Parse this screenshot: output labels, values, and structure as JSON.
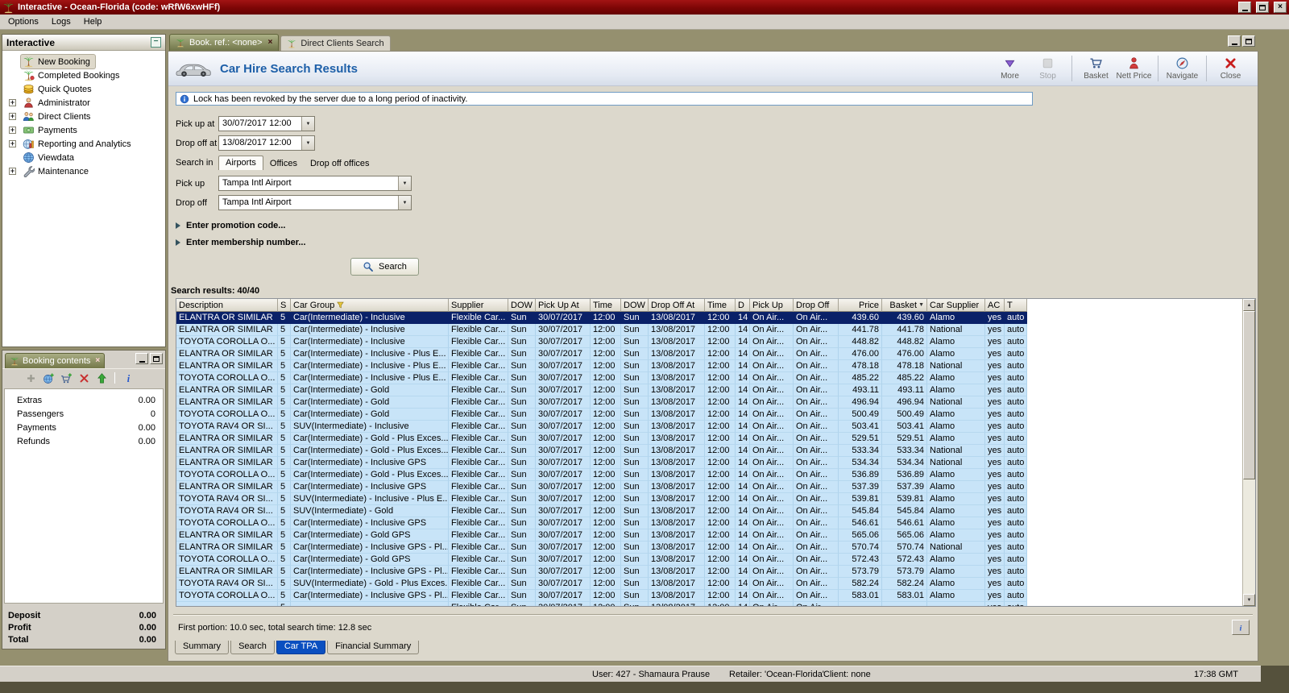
{
  "window": {
    "title": "Interactive - Ocean-Florida (code: wRfW6xwHFf)",
    "menu": [
      {
        "label": "Options"
      },
      {
        "label": "Logs"
      },
      {
        "label": "Help"
      }
    ]
  },
  "sidebar": {
    "title": "Interactive",
    "items": [
      {
        "label": "New Booking",
        "icon": "palm-tree-icon",
        "expandable": false,
        "selected": true
      },
      {
        "label": "Completed Bookings",
        "icon": "completed-bookings-icon",
        "expandable": false
      },
      {
        "label": "Quick Quotes",
        "icon": "quick-quotes-icon",
        "expandable": false
      },
      {
        "label": "Administrator",
        "icon": "administrator-icon",
        "expandable": true
      },
      {
        "label": "Direct Clients",
        "icon": "direct-clients-icon",
        "expandable": true
      },
      {
        "label": "Payments",
        "icon": "payments-icon",
        "expandable": true
      },
      {
        "label": "Reporting and Analytics",
        "icon": "reporting-icon",
        "expandable": true
      },
      {
        "label": "Viewdata",
        "icon": "viewdata-icon",
        "expandable": false
      },
      {
        "label": "Maintenance",
        "icon": "maintenance-icon",
        "expandable": true
      }
    ]
  },
  "booking_contents": {
    "title": "Booking contents",
    "toolbar": [
      {
        "icon": "add-icon"
      },
      {
        "icon": "globe-add-icon"
      },
      {
        "icon": "basket-add-icon"
      },
      {
        "icon": "delete-icon"
      },
      {
        "icon": "export-up-icon"
      },
      {
        "icon": "info-icon",
        "sep_before": true
      }
    ],
    "items": [
      {
        "label": "Extras",
        "value": "0.00"
      },
      {
        "label": "Passengers",
        "value": "0"
      },
      {
        "label": "Payments",
        "value": "0.00"
      },
      {
        "label": "Refunds",
        "value": "0.00"
      }
    ],
    "totals": [
      {
        "label": "Deposit",
        "value": "0.00"
      },
      {
        "label": "Profit",
        "value": "0.00"
      },
      {
        "label": "Total",
        "value": "0.00"
      }
    ]
  },
  "tabs": [
    {
      "label": "Book. ref.: <none>",
      "active": true,
      "closable": true,
      "icon": "palm-tree-icon"
    },
    {
      "label": "Direct Clients Search",
      "active": false,
      "closable": false,
      "icon": "palm-tree-icon"
    }
  ],
  "main": {
    "title": "Car Hire Search Results",
    "info_message": "Lock has been revoked by the server due to a long period of inactivity.",
    "toolbar": [
      {
        "label": "More",
        "icon": "more-icon"
      },
      {
        "label": "Stop",
        "icon": "stop-icon",
        "disabled": true,
        "sep_after": true
      },
      {
        "label": "Basket",
        "icon": "basket-icon"
      },
      {
        "label": "Nett Price",
        "icon": "nett-price-icon",
        "sep_after": true
      },
      {
        "label": "Navigate",
        "icon": "navigate-icon",
        "sep_after": true
      },
      {
        "label": "Close",
        "icon": "close-icon"
      }
    ],
    "form": {
      "pick_up_at": {
        "label": "Pick up at",
        "value": "30/07/2017 12:00"
      },
      "drop_off_at": {
        "label": "Drop off at",
        "value": "13/08/2017 12:00"
      },
      "search_in": {
        "label": "Search in",
        "options": [
          "Airports",
          "Offices",
          "Drop off offices"
        ],
        "selected": "Airports"
      },
      "pick_up": {
        "label": "Pick up",
        "value": "Tampa Intl Airport"
      },
      "drop_off": {
        "label": "Drop off",
        "value": "Tampa Intl Airport"
      }
    },
    "promotion_expander": "Enter promotion code...",
    "membership_expander": "Enter membership number...",
    "search_button": "Search",
    "results_label": "Search results: 40/40",
    "footer_status": "First portion: 10.0 sec, total search time: 12.8 sec",
    "bottom_tabs": [
      {
        "label": "Summary"
      },
      {
        "label": "Search"
      },
      {
        "label": "Car TPA",
        "active": true
      },
      {
        "label": "Financial Summary"
      }
    ]
  },
  "table": {
    "headers": [
      "Description",
      "S",
      "Car Group",
      "Supplier",
      "DOW",
      "Pick Up At",
      "Time",
      "DOW",
      "Drop Off At",
      "Time",
      "D",
      "Pick Up",
      "Drop Off",
      "Price",
      "Basket",
      "Car Supplier",
      "AC",
      "T"
    ],
    "shared": {
      "seats": "5",
      "supplier": "Flexible Car...",
      "dow_pickup": "Sun",
      "pickup_date": "30/07/2017",
      "pickup_time": "12:00",
      "dow_dropoff": "Sun",
      "dropoff_date": "13/08/2017",
      "dropoff_time": "12:00",
      "days": "14",
      "pickup_location": "On Air...",
      "dropoff_location": "On Air...",
      "ac": "yes",
      "transmission": "auto"
    },
    "rows": [
      {
        "description": "ELANTRA OR SIMILAR",
        "car_group": "Car(Intermediate) - Inclusive",
        "price": "439.60",
        "basket": "439.60",
        "car_supplier": "Alamo",
        "selected": true
      },
      {
        "description": "ELANTRA OR SIMILAR",
        "car_group": "Car(Intermediate) - Inclusive",
        "price": "441.78",
        "basket": "441.78",
        "car_supplier": "National"
      },
      {
        "description": "TOYOTA COROLLA O...",
        "car_group": "Car(Intermediate) - Inclusive",
        "price": "448.82",
        "basket": "448.82",
        "car_supplier": "Alamo"
      },
      {
        "description": "ELANTRA OR SIMILAR",
        "car_group": "Car(Intermediate) - Inclusive - Plus E...",
        "price": "476.00",
        "basket": "476.00",
        "car_supplier": "Alamo"
      },
      {
        "description": "ELANTRA OR SIMILAR",
        "car_group": "Car(Intermediate) - Inclusive - Plus E...",
        "price": "478.18",
        "basket": "478.18",
        "car_supplier": "National"
      },
      {
        "description": "TOYOTA COROLLA O...",
        "car_group": "Car(Intermediate) - Inclusive - Plus E...",
        "price": "485.22",
        "basket": "485.22",
        "car_supplier": "Alamo"
      },
      {
        "description": "ELANTRA OR SIMILAR",
        "car_group": "Car(Intermediate) - Gold",
        "price": "493.11",
        "basket": "493.11",
        "car_supplier": "Alamo"
      },
      {
        "description": "ELANTRA OR SIMILAR",
        "car_group": "Car(Intermediate) - Gold",
        "price": "496.94",
        "basket": "496.94",
        "car_supplier": "National"
      },
      {
        "description": "TOYOTA COROLLA O...",
        "car_group": "Car(Intermediate) - Gold",
        "price": "500.49",
        "basket": "500.49",
        "car_supplier": "Alamo"
      },
      {
        "description": "TOYOTA RAV4 OR SI...",
        "car_group": "SUV(Intermediate) - Inclusive",
        "price": "503.41",
        "basket": "503.41",
        "car_supplier": "Alamo"
      },
      {
        "description": "ELANTRA OR SIMILAR",
        "car_group": "Car(Intermediate) - Gold - Plus Exces...",
        "price": "529.51",
        "basket": "529.51",
        "car_supplier": "Alamo"
      },
      {
        "description": "ELANTRA OR SIMILAR",
        "car_group": "Car(Intermediate) - Gold - Plus Exces...",
        "price": "533.34",
        "basket": "533.34",
        "car_supplier": "National"
      },
      {
        "description": "ELANTRA OR SIMILAR",
        "car_group": "Car(Intermediate) - Inclusive GPS",
        "price": "534.34",
        "basket": "534.34",
        "car_supplier": "National"
      },
      {
        "description": "TOYOTA COROLLA O...",
        "car_group": "Car(Intermediate) - Gold - Plus Exces...",
        "price": "536.89",
        "basket": "536.89",
        "car_supplier": "Alamo"
      },
      {
        "description": "ELANTRA OR SIMILAR",
        "car_group": "Car(Intermediate) - Inclusive GPS",
        "price": "537.39",
        "basket": "537.39",
        "car_supplier": "Alamo"
      },
      {
        "description": "TOYOTA RAV4 OR SI...",
        "car_group": "SUV(Intermediate) - Inclusive - Plus E...",
        "price": "539.81",
        "basket": "539.81",
        "car_supplier": "Alamo"
      },
      {
        "description": "TOYOTA RAV4 OR SI...",
        "car_group": "SUV(Intermediate) - Gold",
        "price": "545.84",
        "basket": "545.84",
        "car_supplier": "Alamo"
      },
      {
        "description": "TOYOTA COROLLA O...",
        "car_group": "Car(Intermediate) - Inclusive GPS",
        "price": "546.61",
        "basket": "546.61",
        "car_supplier": "Alamo"
      },
      {
        "description": "ELANTRA OR SIMILAR",
        "car_group": "Car(Intermediate) - Gold GPS",
        "price": "565.06",
        "basket": "565.06",
        "car_supplier": "Alamo"
      },
      {
        "description": "ELANTRA OR SIMILAR",
        "car_group": "Car(Intermediate) - Inclusive GPS - Pl...",
        "price": "570.74",
        "basket": "570.74",
        "car_supplier": "National"
      },
      {
        "description": "TOYOTA COROLLA O...",
        "car_group": "Car(Intermediate) - Gold GPS",
        "price": "572.43",
        "basket": "572.43",
        "car_supplier": "Alamo"
      },
      {
        "description": "ELANTRA OR SIMILAR",
        "car_group": "Car(Intermediate) - Inclusive GPS - Pl...",
        "price": "573.79",
        "basket": "573.79",
        "car_supplier": "Alamo"
      },
      {
        "description": "TOYOTA RAV4 OR SI...",
        "car_group": "SUV(Intermediate) - Gold - Plus Exces...",
        "price": "582.24",
        "basket": "582.24",
        "car_supplier": "Alamo"
      },
      {
        "description": "TOYOTA COROLLA O...",
        "car_group": "Car(Intermediate) - Inclusive GPS - Pl...",
        "price": "583.01",
        "basket": "583.01",
        "car_supplier": "Alamo"
      }
    ],
    "partial_row": {
      "description": "",
      "car_group": "",
      "price": "",
      "basket": "",
      "car_supplier": ""
    }
  },
  "statusbar": {
    "user": "User: 427 - Shamaura Prause",
    "retailer": "Retailer: 'Ocean-Florida'",
    "client": "Client: none",
    "time": "17:38 GMT"
  }
}
